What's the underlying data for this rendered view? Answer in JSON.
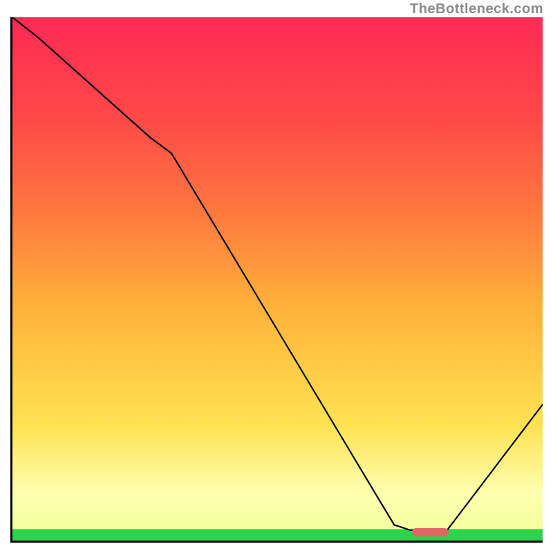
{
  "watermark": "TheBottleneck.com",
  "chart_data": {
    "type": "line",
    "title": "",
    "xlabel": "",
    "ylabel": "",
    "xlim": [
      0,
      100
    ],
    "ylim": [
      0,
      100
    ],
    "x": [
      0,
      5,
      26,
      30,
      72,
      75,
      82,
      100
    ],
    "values": [
      100,
      96,
      77,
      74,
      3,
      2,
      2,
      26
    ],
    "marker": {
      "x_start": 75,
      "x_end": 82,
      "y": 2
    },
    "background_gradient_stops": [
      {
        "pos": 0,
        "color": "#2fd24b"
      },
      {
        "pos": 2.2,
        "color": "#2fd24b"
      },
      {
        "pos": 2.2,
        "color": "#f6ff9e"
      },
      {
        "pos": 9,
        "color": "#fdffb0"
      },
      {
        "pos": 22,
        "color": "#ffe251"
      },
      {
        "pos": 45,
        "color": "#ffb13a"
      },
      {
        "pos": 62,
        "color": "#ff7a3e"
      },
      {
        "pos": 80,
        "color": "#ff4a48"
      },
      {
        "pos": 100,
        "color": "#ff2a55"
      }
    ]
  }
}
